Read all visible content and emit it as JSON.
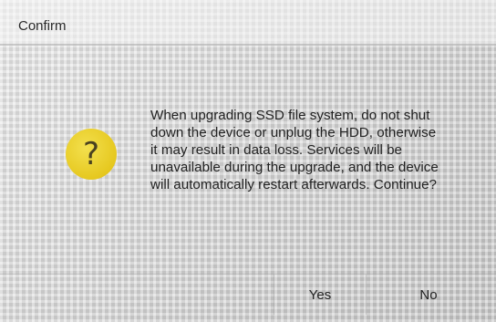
{
  "dialog": {
    "title": "Confirm",
    "icon": "question-icon",
    "icon_glyph": "?",
    "icon_color": "#e6c81f",
    "message_lines": [
      "When upgrading SSD file system, do not shut",
      "down the device or unplug the HDD, otherwise",
      "it may result in data loss. Services will be",
      "unavailable during the upgrade, and the device",
      "will automatically restart afterwards. Continue?"
    ],
    "buttons": {
      "yes_label": "Yes",
      "no_label": "No"
    }
  }
}
